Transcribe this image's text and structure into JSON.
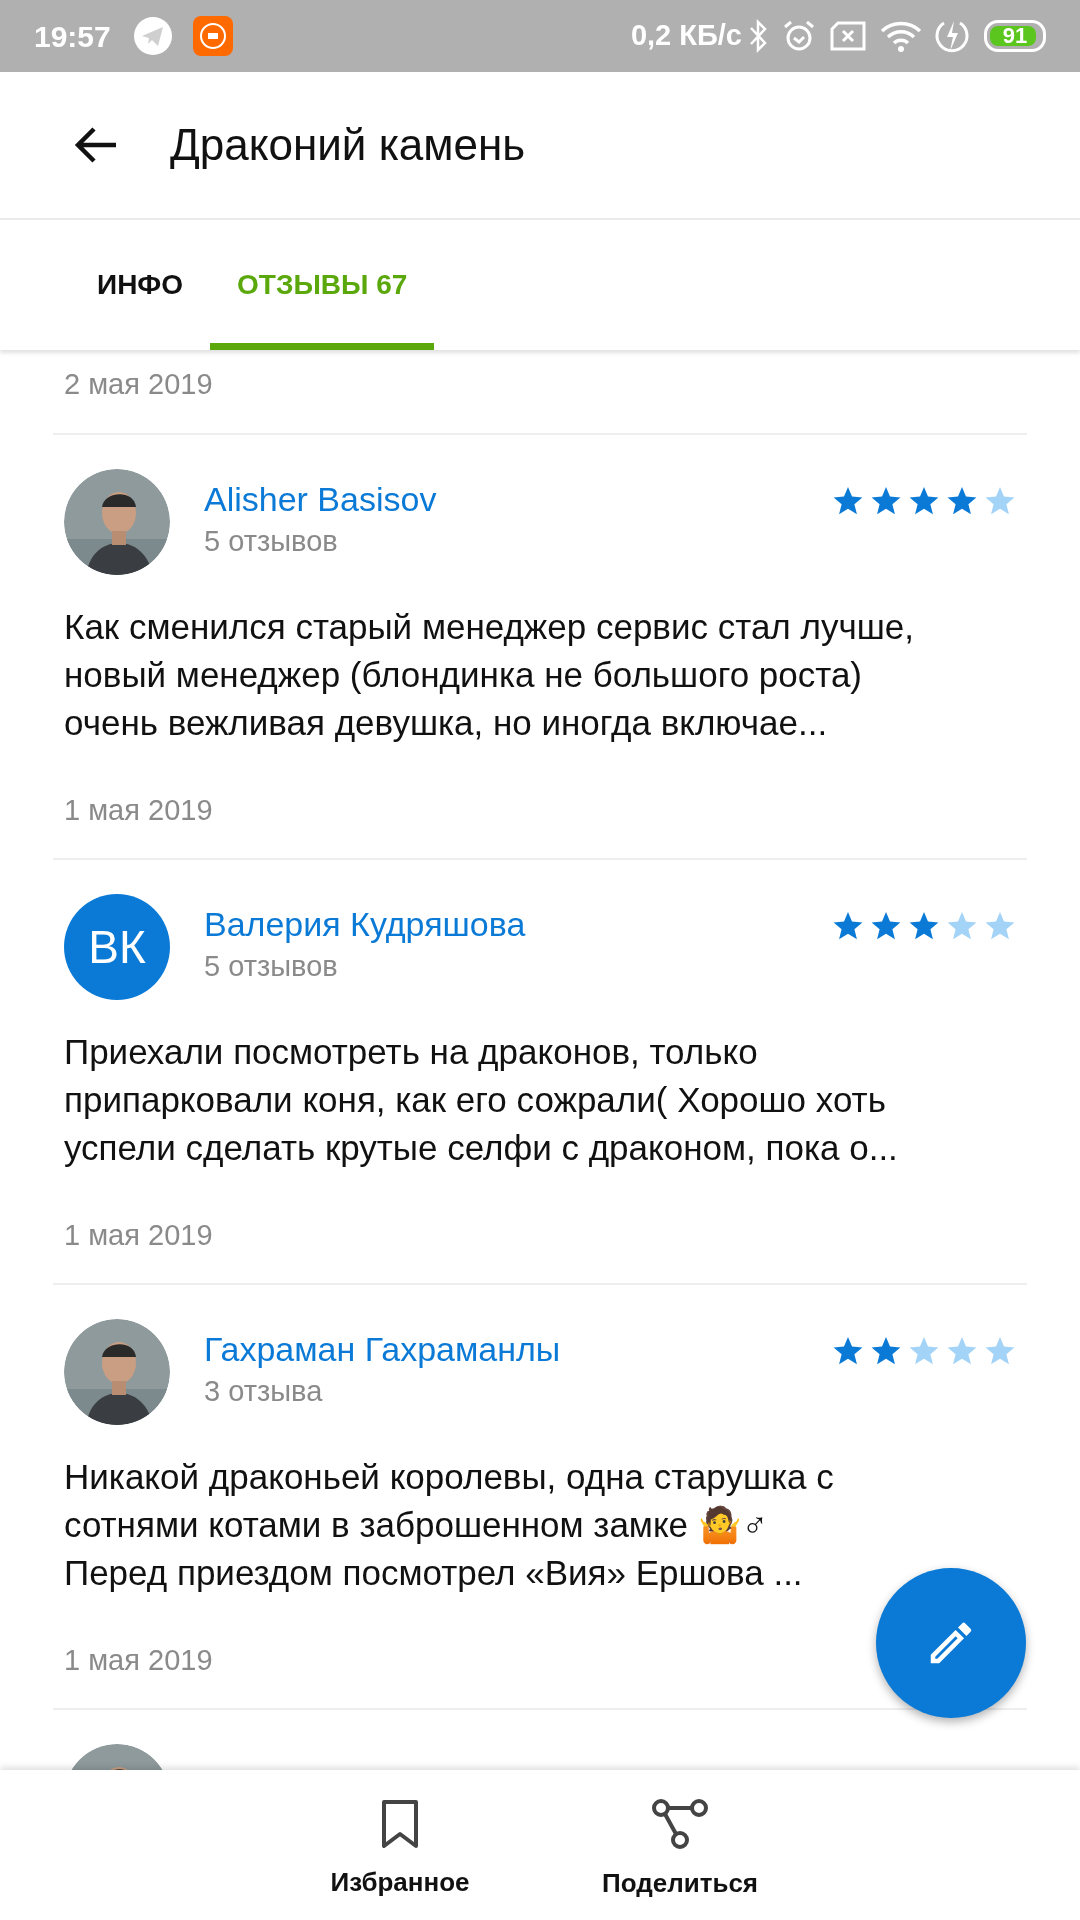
{
  "status_bar": {
    "time": "19:57",
    "network_speed": "0,2 КБ/с",
    "battery": "91"
  },
  "header": {
    "title": "Драконий камень"
  },
  "tabs": [
    {
      "label": "ИНФО",
      "selected": false
    },
    {
      "label": "ОТЗЫВЫ 67",
      "selected": true
    }
  ],
  "previous_review_date": "2 мая 2019",
  "reviews": [
    {
      "avatar": {
        "kind": "picture"
      },
      "name": "Alisher Basisov",
      "review_count": "5 отзывов",
      "stars": 4,
      "text": "Как сменился старый менеджер сервис стал лучше, новый менеджер (блондинка не большого роста) очень вежливая девушка, но иногда включае...",
      "date": "1 мая 2019"
    },
    {
      "avatar": {
        "kind": "initials",
        "initials": "ВК"
      },
      "name": "Валерия Кудряшова",
      "review_count": "5 отзывов",
      "stars": 3,
      "text": "Приехали посмотреть на драконов, только припарковали коня, как его сожрали( Хорошо хоть успели сделать крутые селфи с драконом, пока о...",
      "date": "1 мая 2019"
    },
    {
      "avatar": {
        "kind": "picture"
      },
      "name": "Гахраман Гахраманлы",
      "review_count": "3 отзыва",
      "stars": 2,
      "text": "Никакой драконьей королевы, одна старушка с сотнями котами в заброшенном замке 🤷♂\nПеред приездом посмотрел «Вия» Ершова ...",
      "date": "1 мая 2019"
    },
    {
      "avatar": {
        "kind": "picture"
      }
    }
  ],
  "bottom_actions": [
    {
      "label": "Избранное"
    },
    {
      "label": "Поделиться"
    }
  ]
}
